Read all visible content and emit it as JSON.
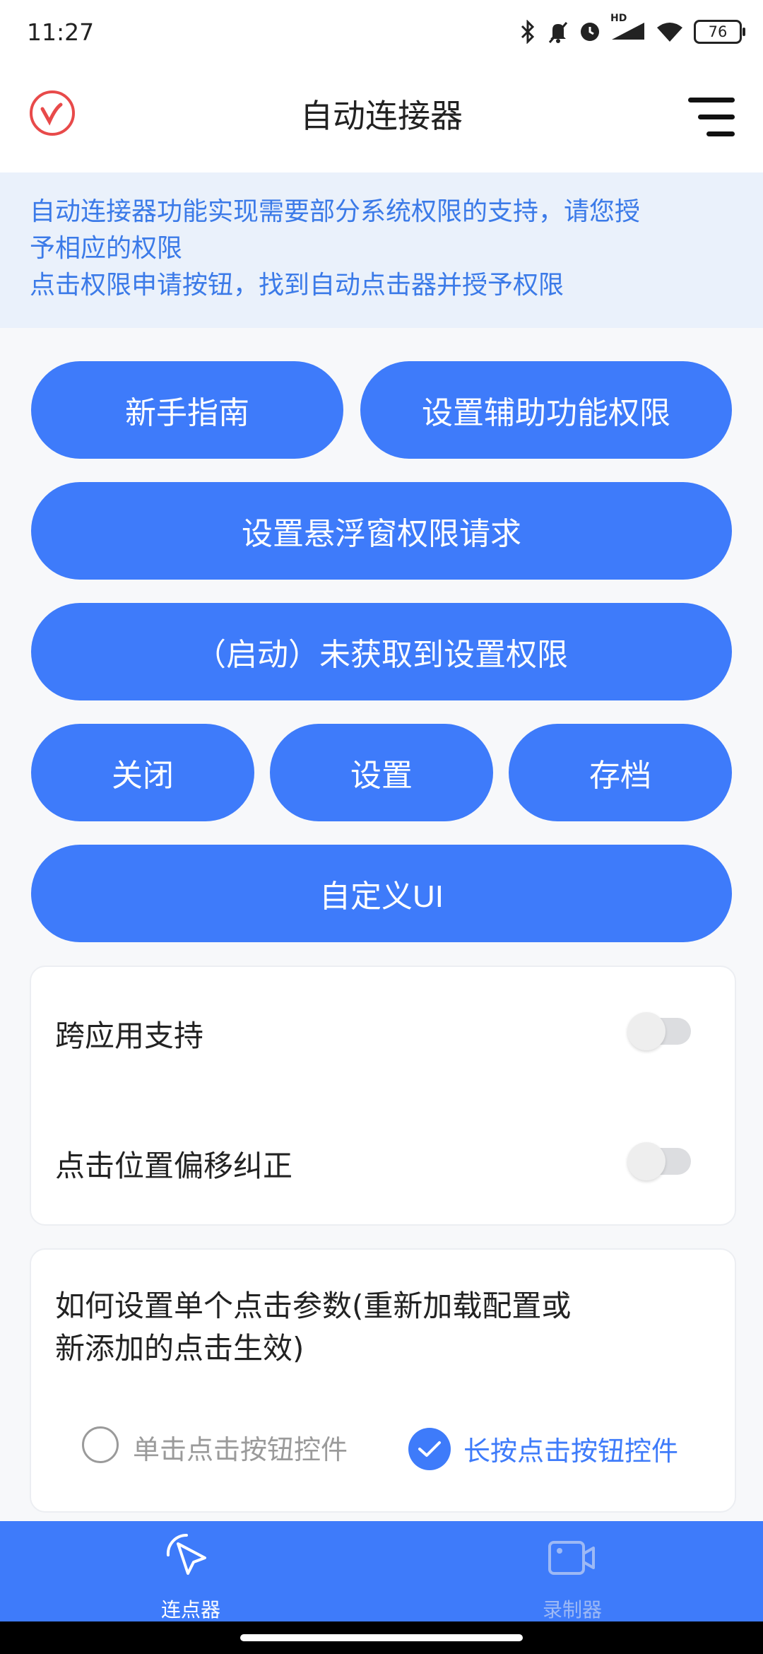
{
  "status_bar": {
    "time": "11:27",
    "network_badge": "HD",
    "battery": "76",
    "icons": [
      "bluetooth-icon",
      "mute-icon",
      "alarm-icon",
      "signal-icon",
      "wifi-icon",
      "battery-icon"
    ]
  },
  "app_bar": {
    "title": "自动连接器",
    "logo_icon": "v-logo-icon",
    "menu_icon": "menu-icon",
    "logo_color": "#e84a4a"
  },
  "notice": {
    "line1": "自动连接器功能实现需要部分系统权限的支持，请您授",
    "line2": "予相应的权限",
    "line3": "点击权限申请按钮，找到自动点击器并授予权限"
  },
  "buttons": {
    "guide": "新手指南",
    "accessibility": "设置辅助功能权限",
    "overlay": "设置悬浮窗权限请求",
    "start": "（启动）未获取到设置权限",
    "close": "关闭",
    "settings": "设置",
    "archive": "存档",
    "custom_ui": "自定义UI"
  },
  "toggles": {
    "cross_app": {
      "label": "跨应用支持",
      "on": false
    },
    "offset_correction": {
      "label": "点击位置偏移纠正",
      "on": false
    }
  },
  "click_params": {
    "title_line1": "如何设置单个点击参数(重新加载配置或",
    "title_line2": "新添加的点击生效)",
    "option_single": "单击点击按钮控件",
    "option_long": "长按点击按钮控件",
    "selected": "option_long"
  },
  "bottom_nav": {
    "clicker": "连点器",
    "recorder": "录制器",
    "active": "clicker"
  },
  "colors": {
    "accent": "#3e7bfa",
    "notice_bg": "#eaf1fb",
    "notice_text": "#3b7ae8",
    "inactive_nav": "#9db9f5"
  }
}
